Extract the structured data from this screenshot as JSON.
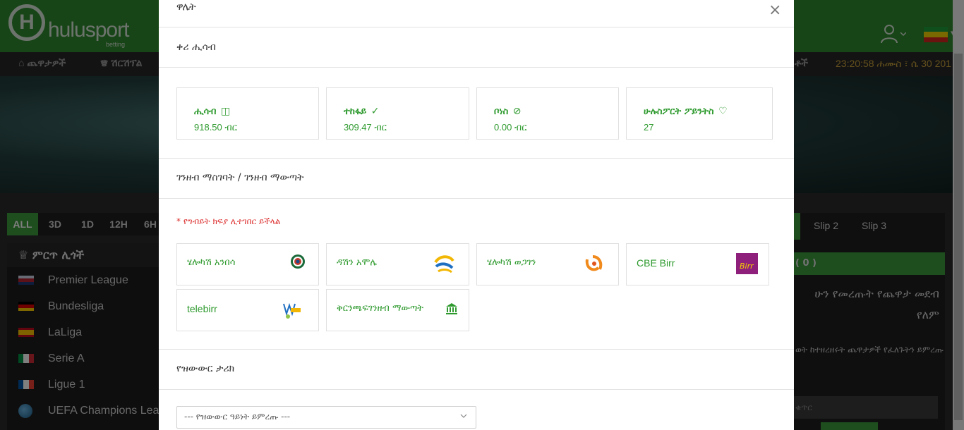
{
  "header": {
    "logo_letter": "H",
    "logo_text": "hulusport",
    "logo_sub": "betting",
    "flag_colors": [
      "#1e9e3a",
      "#f5d000",
      "#d7261e"
    ]
  },
  "nav": {
    "items": [
      "ጨዋታዎች",
      "ሽርሽፕል"
    ],
    "right_item": "ቶች",
    "clock": "23:20:58 ሐሙስ ፣ ሴ 30 201"
  },
  "time_tabs": [
    "ALL",
    "3D",
    "1D",
    "12H",
    "6H"
  ],
  "leagues": {
    "title": "ምርጥ ሊጎች",
    "items": [
      {
        "name": "Premier League",
        "flag": "uk"
      },
      {
        "name": "Bundesliga",
        "flag": "de"
      },
      {
        "name": "LaLiga",
        "flag": "es"
      },
      {
        "name": "Serie A",
        "flag": "it"
      },
      {
        "name": "Ligue 1",
        "flag": "fr"
      },
      {
        "name": "UEFA Champions Lea",
        "flag": "globe"
      }
    ]
  },
  "slip": {
    "tabs": [
      "Slip 2",
      "Slip 3"
    ],
    "count": "( 0 )",
    "message": "ሁን የመረጡት የጨዋታ መደብ የለም",
    "hint": "ወት ከተዘረዘሩት ጨዋታዎች የፈለጉትን ይምረጡ",
    "input_placeholder": "ቁጥር"
  },
  "modal": {
    "title": "ዋሌት",
    "close_symbol": "×",
    "section_account": "ቀሪ ሒሳብ",
    "balances": [
      {
        "label": "ሒሳብ",
        "icon": "◫",
        "value": "918.50 ብር"
      },
      {
        "label": "ተከፋይ",
        "icon": "✓",
        "value": "309.47 ብር"
      },
      {
        "label": "ቦነስ",
        "icon": "⊘",
        "value": "0.00 ብር"
      },
      {
        "label": "ሁሉስፖርት ፖይንትስ",
        "icon": "♡",
        "value": "27"
      }
    ],
    "section_payments": "ገንዘብ ማስገባት / ገንዘብ ማውጣት",
    "note": "* የግብይት ክፍያ ሊተገበር ይችላል",
    "methods": [
      {
        "label": "ሄሎካሽ አንበሳ",
        "logo": "lion-bank-logo"
      },
      {
        "label": "ዳሽን አሞሌ",
        "logo": "amole-logo"
      },
      {
        "label": "ሄሎካሽ ወጋገን",
        "logo": "wegagen-logo"
      },
      {
        "label": "CBE Birr",
        "logo": "cbe-birr-logo"
      },
      {
        "label": "telebirr",
        "logo": "telebirr-logo"
      },
      {
        "label": "ቅርንጫፍገንዘብ ማውጣት",
        "logo": "bank-icon"
      }
    ],
    "section_history": "የዝውውር ታሪክ",
    "history_select_placeholder": "--- የዝውውር ዓይነት ይምረጡ ---"
  },
  "colors": {
    "brand_green": "#2f8a2f",
    "accent_green": "#2e9a2e",
    "clock_gold": "#c9a23a",
    "note_red": "#dd3333"
  }
}
